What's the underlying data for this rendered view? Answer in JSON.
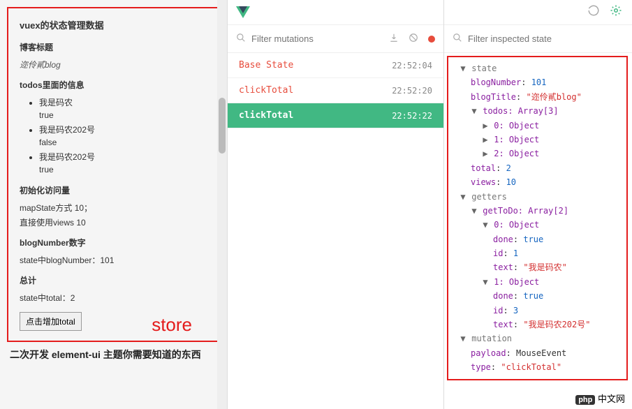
{
  "left": {
    "title": "vuex的状态管理数据",
    "blogLabel": "博客标题",
    "blogValue": "迩伶貳blog",
    "todosLabel": "todos里面的信息",
    "todos": [
      {
        "text": "我是码农",
        "done": "true"
      },
      {
        "text": "我是码农202号",
        "done": "false"
      },
      {
        "text": "我是码农202号",
        "done": "true"
      }
    ],
    "viewsLabel": "初始化访问量",
    "viewsLine1": "mapState方式 10；",
    "viewsLine2": "直接使用views 10",
    "blogNumLabel": "blogNumber数字",
    "blogNumLine": "state中blogNumber：101",
    "totalLabel": "总计",
    "totalLine": "state中total：2",
    "storeLabel": "store",
    "buttonLabel": "点击增加total",
    "articleBelow": "二次开发 element-ui 主题你需要知道的东西"
  },
  "mid": {
    "filterPlaceholder": "Filter mutations",
    "rows": [
      {
        "name": "Base State",
        "time": "22:52:04"
      },
      {
        "name": "clickTotal",
        "time": "22:52:20"
      },
      {
        "name": "clickTotal",
        "time": "22:52:22"
      }
    ]
  },
  "right": {
    "filterPlaceholder": "Filter inspected state",
    "state": {
      "label": "state",
      "blogNumber": "101",
      "blogTitle": "\"迩伶貳blog\"",
      "todosLabel": "todos: Array[3]",
      "todosItems": [
        "0: Object",
        "1: Object",
        "2: Object"
      ],
      "total": "2",
      "views": "10"
    },
    "getters": {
      "label": "getters",
      "getToDo": "getToDo: Array[2]",
      "items": [
        {
          "idx": "0: Object",
          "done": "true",
          "id": "1",
          "text": "\"我是码农\""
        },
        {
          "idx": "1: Object",
          "done": "true",
          "id": "3",
          "text": "\"我是码农202号\""
        }
      ]
    },
    "mutation": {
      "label": "mutation",
      "payload": "MouseEvent",
      "type": "\"clickTotal\""
    }
  },
  "watermark": "php中文网"
}
